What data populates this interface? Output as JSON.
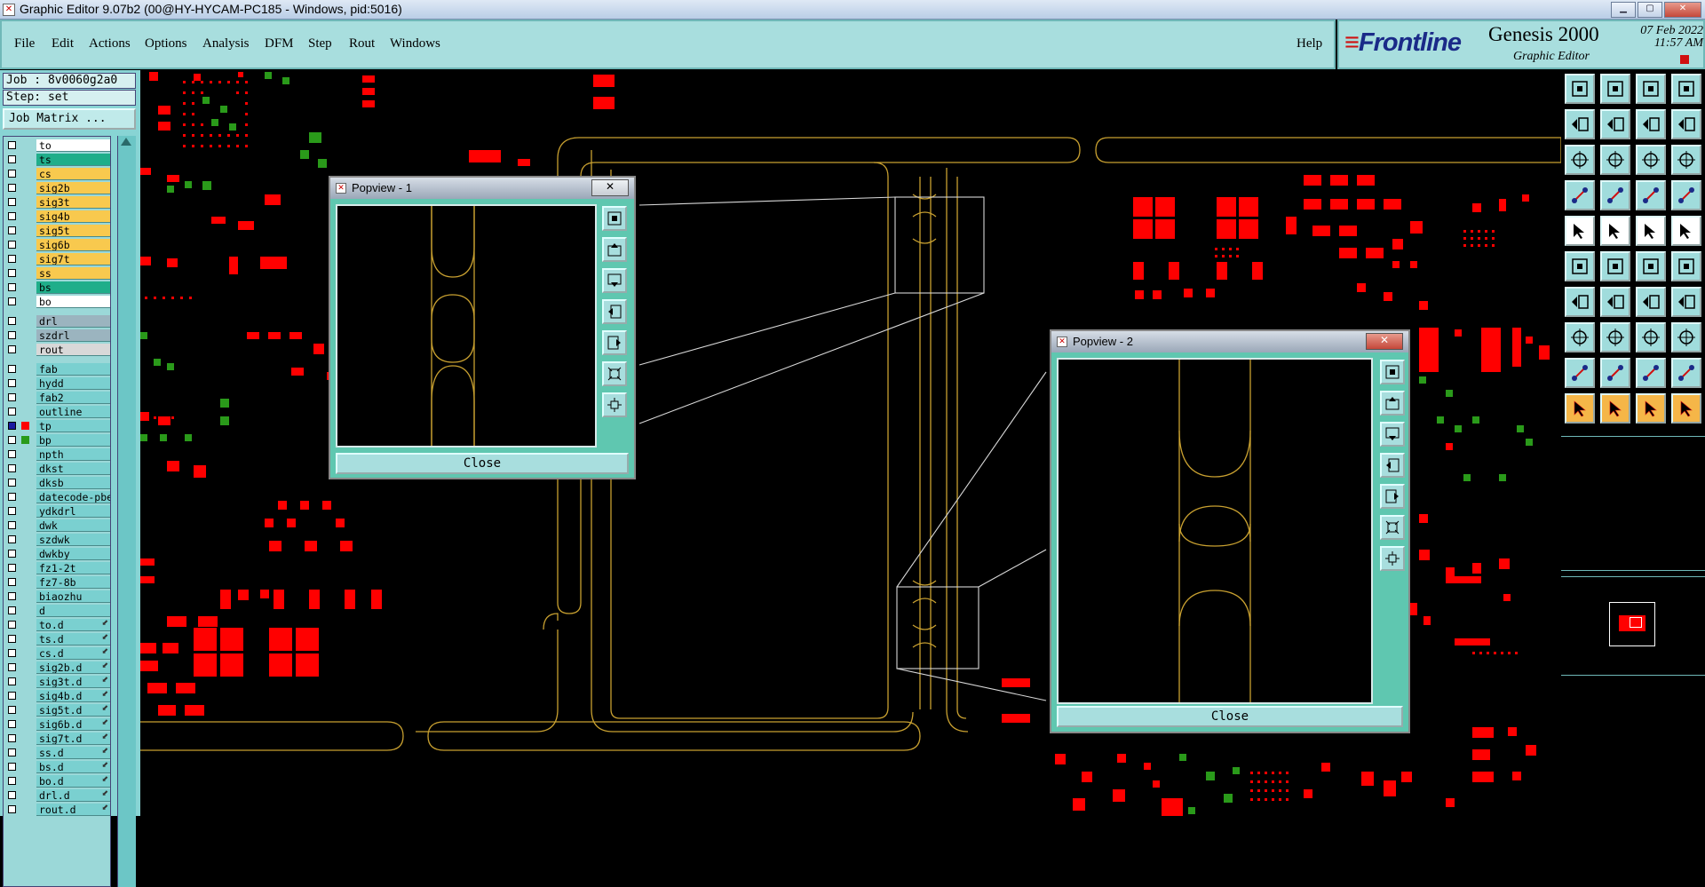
{
  "window": {
    "title": "Graphic Editor 9.07b2 (00@HY-HYCAM-PC185 - Windows, pid:5016)"
  },
  "menu": {
    "items": [
      "File",
      "Edit",
      "Actions",
      "Options",
      "Analysis",
      "DFM",
      "Step",
      "Rout",
      "Windows"
    ],
    "help": "Help"
  },
  "brand": {
    "logo": "Frontline",
    "product": "Genesis 2000",
    "subtitle": "Graphic Editor",
    "date": "07 Feb 2022",
    "time": "11:57 AM"
  },
  "job": {
    "job_label": "Job : 8v0060g2a0",
    "step_label": "Step: set",
    "matrix_button": "Job Matrix ..."
  },
  "layers": [
    {
      "name": "to",
      "color": "#ffffff"
    },
    {
      "name": "ts",
      "color": "#1fae8a"
    },
    {
      "name": "cs",
      "color": "#f8c94e"
    },
    {
      "name": "sig2b",
      "color": "#f8c94e"
    },
    {
      "name": "sig3t",
      "color": "#f8c94e"
    },
    {
      "name": "sig4b",
      "color": "#f8c94e"
    },
    {
      "name": "sig5t",
      "color": "#f8c94e"
    },
    {
      "name": "sig6b",
      "color": "#f8c94e"
    },
    {
      "name": "sig7t",
      "color": "#f8c94e"
    },
    {
      "name": "ss",
      "color": "#f8c94e"
    },
    {
      "name": "bs",
      "color": "#1fae8a"
    },
    {
      "name": "bo",
      "color": "#ffffff"
    },
    {
      "name": "drl",
      "color": "#9bb4bf"
    },
    {
      "name": "szdrl",
      "color": "#9bb4bf"
    },
    {
      "name": "rout",
      "color": "#d8d8d8"
    },
    {
      "name": "fab",
      "color": "#7ad0d0"
    },
    {
      "name": "hydd",
      "color": "#7ad0d0"
    },
    {
      "name": "fab2",
      "color": "#7ad0d0"
    },
    {
      "name": "outline",
      "color": "#7ad0d0"
    },
    {
      "name": "tp",
      "color": "#7ad0d0"
    },
    {
      "name": "bp",
      "color": "#7ad0d0"
    },
    {
      "name": "npth",
      "color": "#7ad0d0"
    },
    {
      "name": "dkst",
      "color": "#7ad0d0"
    },
    {
      "name": "dksb",
      "color": "#7ad0d0"
    },
    {
      "name": "datecode-pbe",
      "color": "#7ad0d0"
    },
    {
      "name": "ydkdrl",
      "color": "#7ad0d0"
    },
    {
      "name": "dwk",
      "color": "#7ad0d0"
    },
    {
      "name": "szdwk",
      "color": "#7ad0d0"
    },
    {
      "name": "dwkby",
      "color": "#7ad0d0"
    },
    {
      "name": "fz1-2t",
      "color": "#7ad0d0"
    },
    {
      "name": "fz7-8b",
      "color": "#7ad0d0"
    },
    {
      "name": "biaozhu",
      "color": "#7ad0d0"
    },
    {
      "name": "d",
      "color": "#7ad0d0"
    },
    {
      "name": "to.d",
      "color": "#7ad0d0"
    },
    {
      "name": "ts.d",
      "color": "#7ad0d0"
    },
    {
      "name": "cs.d",
      "color": "#7ad0d0"
    },
    {
      "name": "sig2b.d",
      "color": "#7ad0d0"
    },
    {
      "name": "sig3t.d",
      "color": "#7ad0d0"
    },
    {
      "name": "sig4b.d",
      "color": "#7ad0d0"
    },
    {
      "name": "sig5t.d",
      "color": "#7ad0d0"
    },
    {
      "name": "sig6b.d",
      "color": "#7ad0d0"
    },
    {
      "name": "sig7t.d",
      "color": "#7ad0d0"
    },
    {
      "name": "ss.d",
      "color": "#7ad0d0"
    },
    {
      "name": "bs.d",
      "color": "#7ad0d0"
    },
    {
      "name": "bo.d",
      "color": "#7ad0d0"
    },
    {
      "name": "drl.d",
      "color": "#7ad0d0"
    },
    {
      "name": "rout.d",
      "color": "#7ad0d0"
    }
  ],
  "popview1": {
    "title": "Popview - 1",
    "close_label": "Close"
  },
  "popview2": {
    "title": "Popview - 2",
    "close_label": "Close"
  },
  "colors": {
    "pad_red": "#ff0000",
    "pad_green": "#2a9a1a",
    "outline_gold": "#c8a030",
    "panel_teal": "#a8dede"
  }
}
